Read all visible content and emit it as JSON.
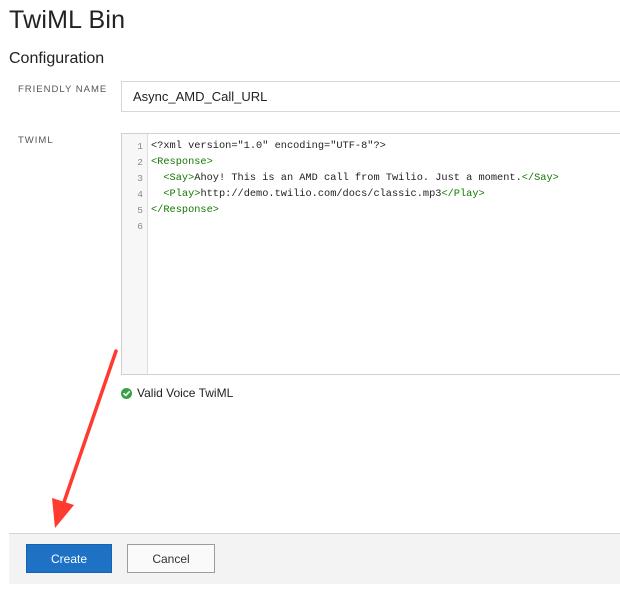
{
  "page": {
    "title": "TwiML Bin"
  },
  "section": {
    "title": "Configuration"
  },
  "friendly_name": {
    "label": "FRIENDLY NAME",
    "value": "Async_AMD_Call_URL"
  },
  "twiml": {
    "label": "TWIML",
    "line_numbers": [
      "1",
      "2",
      "3",
      "4",
      "5",
      "6"
    ],
    "lines": [
      [
        {
          "t": "<?xml version=\"1.0\" encoding=\"UTF-8\"?>",
          "c": "plain"
        }
      ],
      [
        {
          "t": "<Response>",
          "c": "tag"
        }
      ],
      [
        {
          "t": "  ",
          "c": "plain"
        },
        {
          "t": "<Say>",
          "c": "tag"
        },
        {
          "t": "Ahoy! This is an AMD call from Twilio. Just a moment.",
          "c": "plain"
        },
        {
          "t": "</Say>",
          "c": "tag"
        }
      ],
      [
        {
          "t": "  ",
          "c": "plain"
        },
        {
          "t": "<Play>",
          "c": "tag"
        },
        {
          "t": "http://demo.twilio.com/docs/classic.mp3",
          "c": "plain"
        },
        {
          "t": "</Play>",
          "c": "tag"
        }
      ],
      [
        {
          "t": "</Response>",
          "c": "tag"
        }
      ],
      [
        {
          "t": "",
          "c": "plain"
        }
      ]
    ]
  },
  "validation": {
    "text": "Valid Voice TwiML",
    "icon": "check-circle-icon",
    "color": "#36a244"
  },
  "footer": {
    "create_label": "Create",
    "cancel_label": "Cancel"
  },
  "colors": {
    "primary": "#1d72c5",
    "xml_tag": "#117700",
    "annotation_arrow": "#ff3b30"
  },
  "annotation": {
    "icon": "red-arrow"
  }
}
